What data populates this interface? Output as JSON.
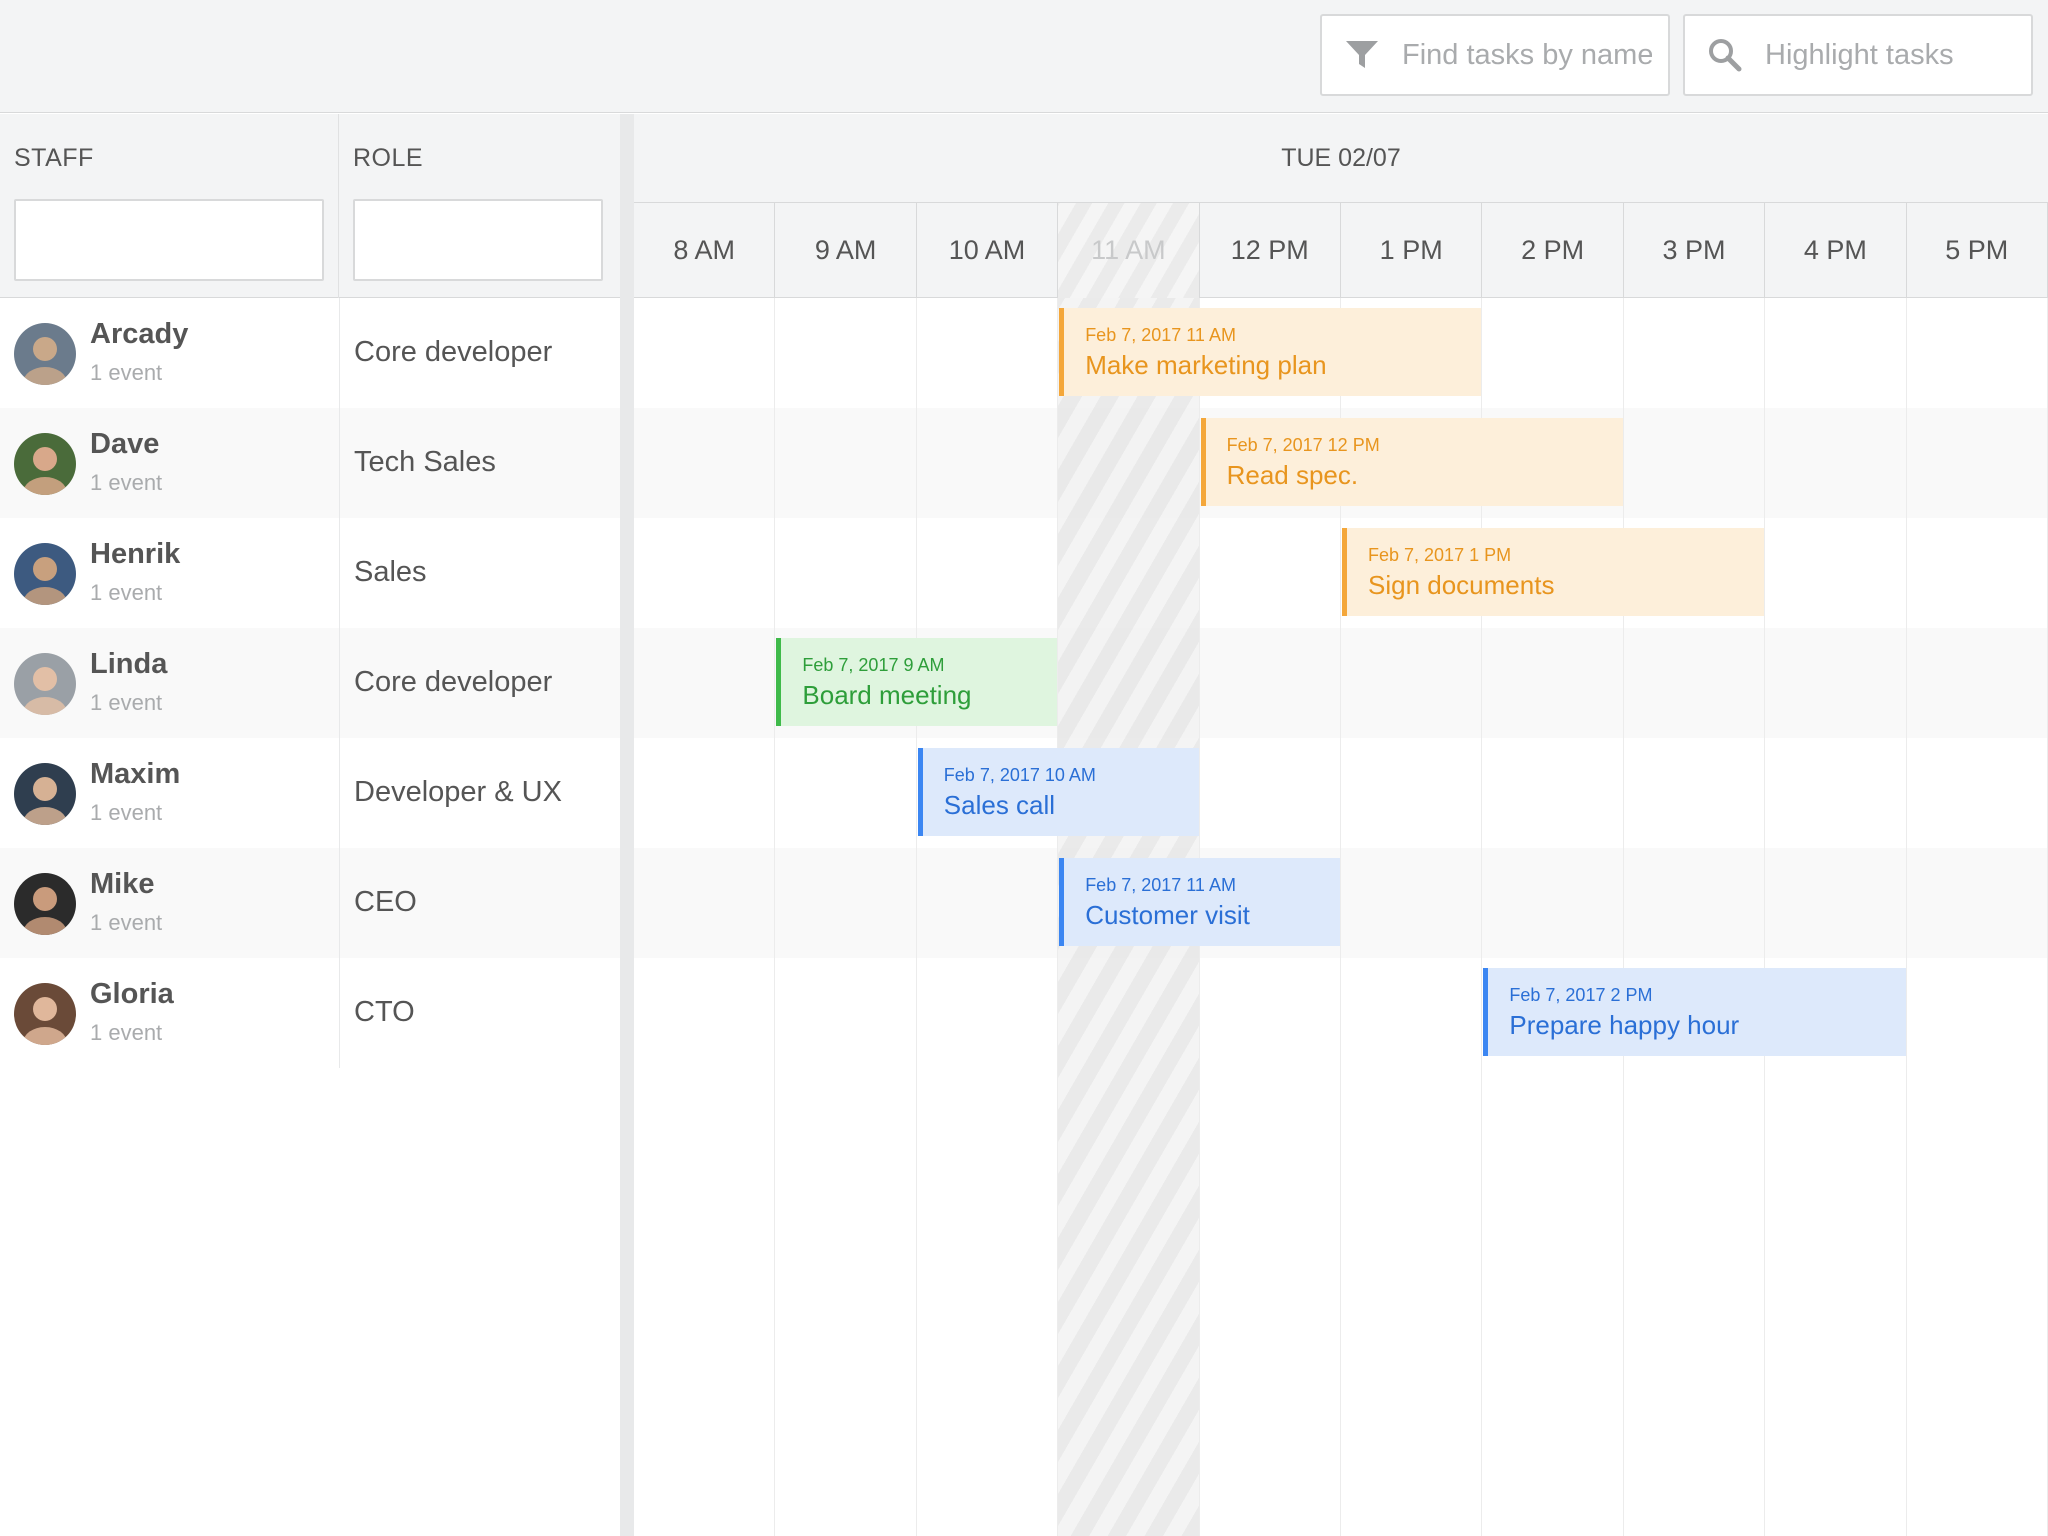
{
  "toolbar": {
    "filter_placeholder": "Find tasks by name",
    "highlight_placeholder": "Highlight tasks",
    "filter_icon": "filter-icon",
    "search_icon": "search-icon"
  },
  "columns": {
    "staff": "STAFF",
    "role": "ROLE"
  },
  "schedule": {
    "day": "TUE 02/07",
    "hours": [
      "8 AM",
      "9 AM",
      "10 AM",
      "11 AM",
      "12 PM",
      "1 PM",
      "2 PM",
      "3 PM",
      "4 PM",
      "5 PM"
    ],
    "nonworking_hour": "11 AM"
  },
  "staff": [
    {
      "name": "Arcady",
      "events": "1 event",
      "role": "Core developer"
    },
    {
      "name": "Dave",
      "events": "1 event",
      "role": "Tech Sales"
    },
    {
      "name": "Henrik",
      "events": "1 event",
      "role": "Sales"
    },
    {
      "name": "Linda",
      "events": "1 event",
      "role": "Core developer"
    },
    {
      "name": "Maxim",
      "events": "1 event",
      "role": "Developer & UX"
    },
    {
      "name": "Mike",
      "events": "1 event",
      "role": "CEO"
    },
    {
      "name": "Gloria",
      "events": "1 event",
      "role": "CTO"
    }
  ],
  "events": [
    {
      "row": 0,
      "start": 3,
      "duration": 3,
      "date": "Feb 7, 2017 11 AM",
      "title": "Make marketing plan",
      "color": "orange"
    },
    {
      "row": 1,
      "start": 4,
      "duration": 3,
      "date": "Feb 7, 2017 12 PM",
      "title": "Read spec.",
      "color": "orange"
    },
    {
      "row": 2,
      "start": 5,
      "duration": 3,
      "date": "Feb 7, 2017 1 PM",
      "title": "Sign documents",
      "color": "orange"
    },
    {
      "row": 3,
      "start": 1,
      "duration": 2,
      "date": "Feb 7, 2017 9 AM",
      "title": "Board meeting",
      "color": "green"
    },
    {
      "row": 4,
      "start": 2,
      "duration": 2,
      "date": "Feb 7, 2017 10 AM",
      "title": "Sales call",
      "color": "blue"
    },
    {
      "row": 5,
      "start": 3,
      "duration": 2,
      "date": "Feb 7, 2017 11 AM",
      "title": "Customer visit",
      "color": "blue"
    },
    {
      "row": 6,
      "start": 6,
      "duration": 3,
      "date": "Feb 7, 2017 2 PM",
      "title": "Prepare happy hour",
      "color": "blue"
    }
  ],
  "colors": {
    "orange": "#f4a73a",
    "green": "#3fba4a",
    "blue": "#3b86f2"
  }
}
